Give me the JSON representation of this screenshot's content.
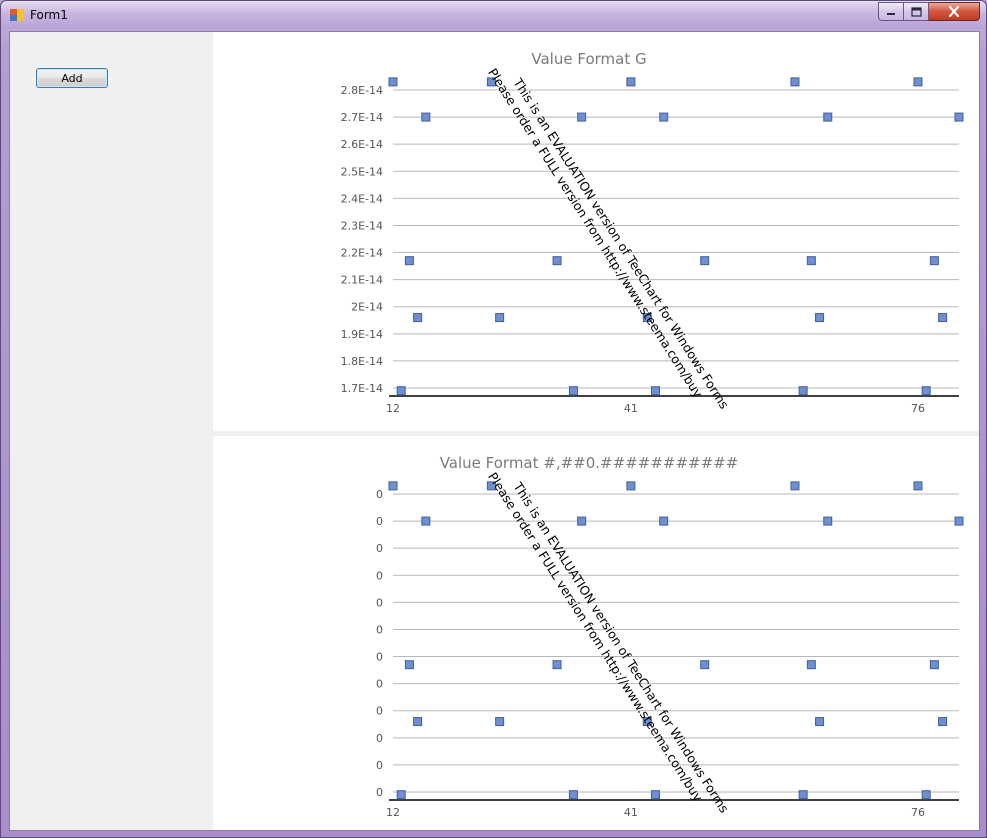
{
  "window": {
    "title": "Form1",
    "icon": "winforms-app-icon",
    "controls": [
      "minimize-icon",
      "maximize-icon",
      "close-icon"
    ]
  },
  "sidebar": {
    "add_label": "Add"
  },
  "watermark": {
    "line1": "This is an EVALUATION version of TeeChart for Windows Forms",
    "line2": "Please order a FULL version from http://www.steema.com/buy"
  },
  "colors": {
    "point": "#6f8fcf",
    "point_border": "#3f5f9f",
    "grid": "#b8b8b8",
    "axis": "#404040",
    "title": "#7a7a7a"
  },
  "chart_data": [
    {
      "type": "scatter",
      "title": "Value Format G",
      "xticks": [
        "12",
        "41",
        "76"
      ],
      "yticks": [
        "2.8E-14",
        "2.7E-14",
        "2.6E-14",
        "2.5E-14",
        "2.4E-14",
        "2.3E-14",
        "2.2E-14",
        "2.1E-14",
        "2E-14",
        "1.9E-14",
        "1.8E-14",
        "1.7E-14"
      ],
      "ylim": [
        1.7e-14,
        2.8e-14
      ],
      "xlim": [
        12,
        81
      ],
      "grid": true,
      "points": [
        {
          "x": 12,
          "y": 2.83e-14
        },
        {
          "x": 24,
          "y": 2.83e-14
        },
        {
          "x": 41,
          "y": 2.83e-14
        },
        {
          "x": 61,
          "y": 2.83e-14
        },
        {
          "x": 76,
          "y": 2.83e-14
        },
        {
          "x": 16,
          "y": 2.7e-14
        },
        {
          "x": 35,
          "y": 2.7e-14
        },
        {
          "x": 45,
          "y": 2.7e-14
        },
        {
          "x": 65,
          "y": 2.7e-14
        },
        {
          "x": 81,
          "y": 2.7e-14
        },
        {
          "x": 14,
          "y": 2.17e-14
        },
        {
          "x": 32,
          "y": 2.17e-14
        },
        {
          "x": 50,
          "y": 2.17e-14
        },
        {
          "x": 63,
          "y": 2.17e-14
        },
        {
          "x": 78,
          "y": 2.17e-14
        },
        {
          "x": 15,
          "y": 1.96e-14
        },
        {
          "x": 25,
          "y": 1.96e-14
        },
        {
          "x": 43,
          "y": 1.96e-14
        },
        {
          "x": 64,
          "y": 1.96e-14
        },
        {
          "x": 79,
          "y": 1.96e-14
        },
        {
          "x": 13,
          "y": 1.69e-14
        },
        {
          "x": 34,
          "y": 1.69e-14
        },
        {
          "x": 44,
          "y": 1.69e-14
        },
        {
          "x": 62,
          "y": 1.69e-14
        },
        {
          "x": 77,
          "y": 1.69e-14
        }
      ]
    },
    {
      "type": "scatter",
      "title": "Value Format #,##0.###########",
      "xticks": [
        "12",
        "41",
        "76"
      ],
      "yticks": [
        "0",
        "0",
        "0",
        "0",
        "0",
        "0",
        "0",
        "0",
        "0",
        "0",
        "0",
        "0"
      ],
      "ylim": [
        1.7e-14,
        2.8e-14
      ],
      "xlim": [
        12,
        81
      ],
      "grid": true,
      "points": [
        {
          "x": 12,
          "y": 2.83e-14
        },
        {
          "x": 24,
          "y": 2.83e-14
        },
        {
          "x": 41,
          "y": 2.83e-14
        },
        {
          "x": 61,
          "y": 2.83e-14
        },
        {
          "x": 76,
          "y": 2.83e-14
        },
        {
          "x": 16,
          "y": 2.7e-14
        },
        {
          "x": 35,
          "y": 2.7e-14
        },
        {
          "x": 45,
          "y": 2.7e-14
        },
        {
          "x": 65,
          "y": 2.7e-14
        },
        {
          "x": 81,
          "y": 2.7e-14
        },
        {
          "x": 14,
          "y": 2.17e-14
        },
        {
          "x": 32,
          "y": 2.17e-14
        },
        {
          "x": 50,
          "y": 2.17e-14
        },
        {
          "x": 63,
          "y": 2.17e-14
        },
        {
          "x": 78,
          "y": 2.17e-14
        },
        {
          "x": 15,
          "y": 1.96e-14
        },
        {
          "x": 25,
          "y": 1.96e-14
        },
        {
          "x": 43,
          "y": 1.96e-14
        },
        {
          "x": 64,
          "y": 1.96e-14
        },
        {
          "x": 79,
          "y": 1.96e-14
        },
        {
          "x": 13,
          "y": 1.69e-14
        },
        {
          "x": 34,
          "y": 1.69e-14
        },
        {
          "x": 44,
          "y": 1.69e-14
        },
        {
          "x": 62,
          "y": 1.69e-14
        },
        {
          "x": 77,
          "y": 1.69e-14
        }
      ]
    }
  ]
}
